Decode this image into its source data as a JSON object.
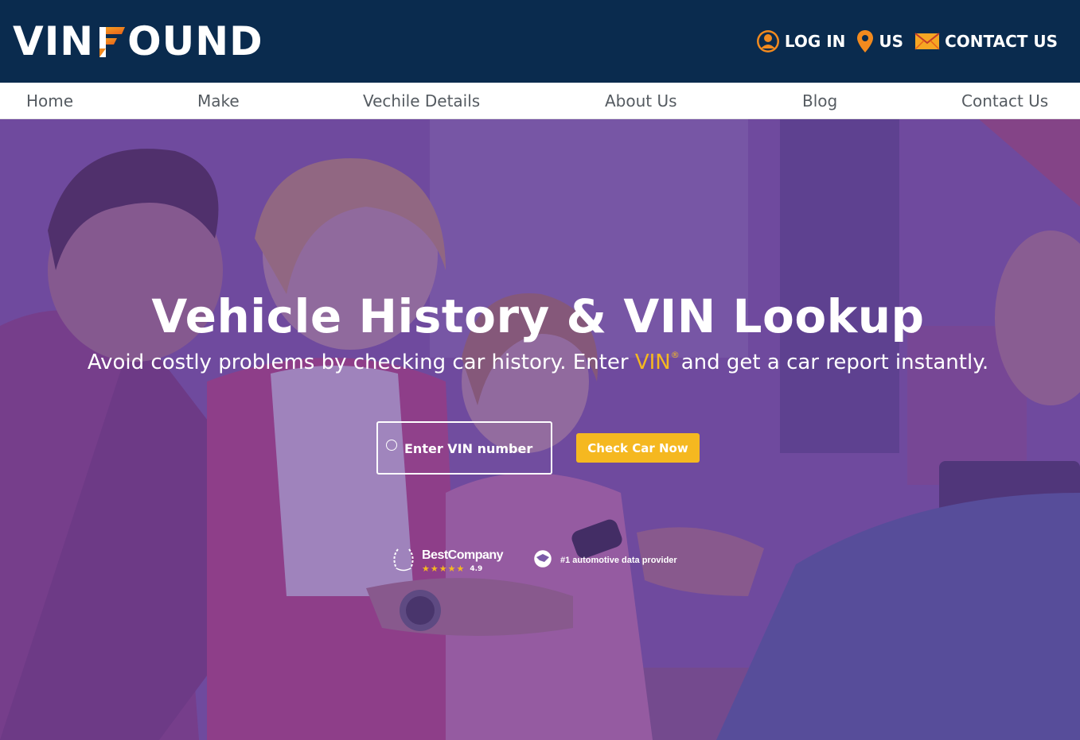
{
  "header": {
    "logo_pre": "VIN",
    "logo_post": "OUND",
    "actions": [
      {
        "label": "LOG IN",
        "icon": "user-icon"
      },
      {
        "label": "US",
        "icon": "location-pin-icon"
      },
      {
        "label": "CONTACT US",
        "icon": "mail-icon"
      }
    ]
  },
  "nav": {
    "items": [
      {
        "label": "Home"
      },
      {
        "label": "Make"
      },
      {
        "label": "Vechile Details"
      },
      {
        "label": "About Us"
      },
      {
        "label": "Blog"
      },
      {
        "label": "Contact Us"
      }
    ]
  },
  "hero": {
    "title": "Vehicle History & VIN Lookup",
    "subtitle_before": "Avoid costly problems by checking car history. Enter ",
    "subtitle_vin": "VIN",
    "subtitle_sup": "®",
    "subtitle_after": "and get a car report instantly.",
    "input_placeholder": "Enter VIN number",
    "button_label": "Check Car Now",
    "badge_company": "BestCompany",
    "badge_stars": "★★★★★",
    "badge_score": "4.9",
    "badge_provider": "#1 automotive data provider"
  },
  "colors": {
    "header_bg": "#0a2b4e",
    "accent": "#f5b820",
    "logo_orange": "#f28a1e",
    "nav_text": "#555b61"
  }
}
